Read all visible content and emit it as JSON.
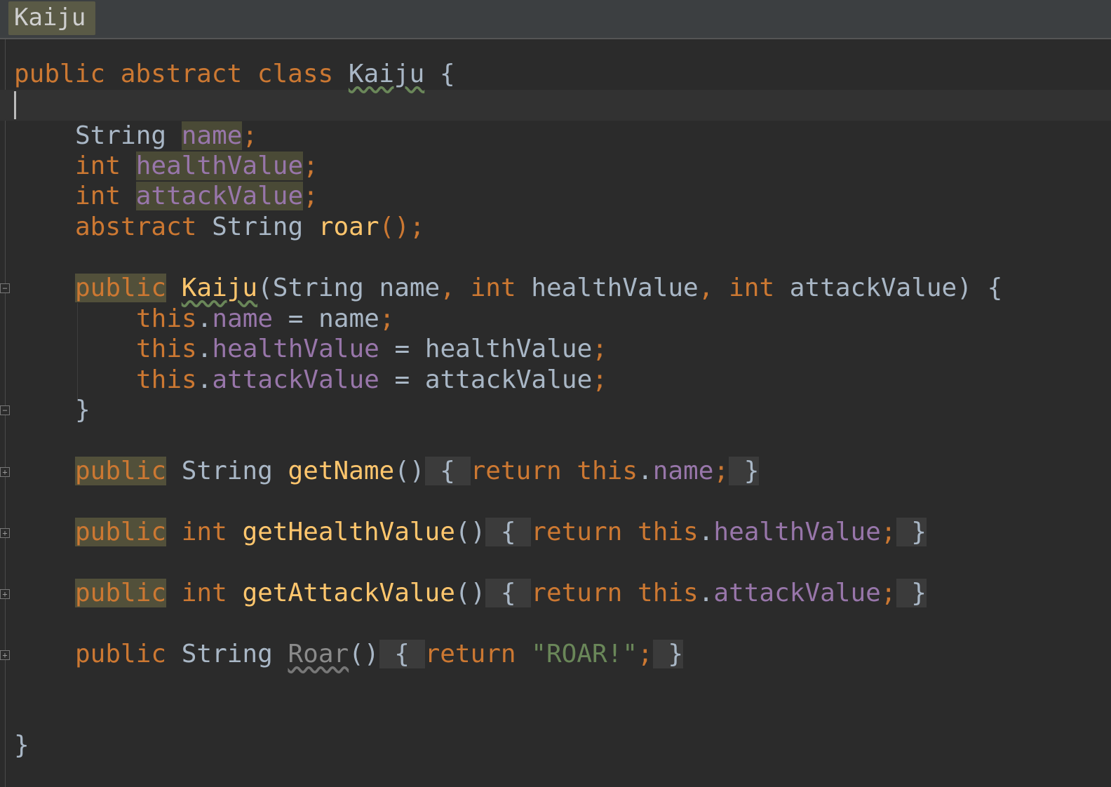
{
  "tab": {
    "label": "Kaiju"
  },
  "code": {
    "l1": {
      "k1": "public",
      "k2": "abstract",
      "k3": "class",
      "name": "Kaiju",
      "brace": "{"
    },
    "l2": {
      "type": "String",
      "field": "name",
      "semi": ";"
    },
    "l3": {
      "type": "int",
      "field": "healthValue",
      "semi": ";"
    },
    "l4": {
      "type": "int",
      "field": "attackValue",
      "semi": ";"
    },
    "l5": {
      "k1": "abstract",
      "type": "String",
      "method": "roar",
      "rest": "();"
    },
    "l6": {
      "k1": "public",
      "name": "Kaiju",
      "open": "(",
      "t1": "String",
      "p1": " name",
      "c1": ",",
      "t2": "int",
      "p2": " healthValue",
      "c2": ",",
      "t3": "int",
      "p3": " attackValue",
      "close": ") {"
    },
    "l7": {
      "this": "this",
      "dot": ".",
      "field": "name",
      "rest": " = name",
      "semi": ";"
    },
    "l8": {
      "this": "this",
      "dot": ".",
      "field": "healthValue",
      "rest": " = healthValue",
      "semi": ";"
    },
    "l9": {
      "this": "this",
      "dot": ".",
      "field": "attackValue",
      "rest": " = attackValue",
      "semi": ";"
    },
    "l10": {
      "brace": "}"
    },
    "l11": {
      "k1": "public",
      "type": "String",
      "method": "getName",
      "paren": "()",
      "ob": " { ",
      "ret": "return",
      "this": "this",
      "dot": ".",
      "field": "name",
      "semi": ";",
      "cb": " }"
    },
    "l12": {
      "k1": "public",
      "type": "int",
      "method": "getHealthValue",
      "paren": "()",
      "ob": " { ",
      "ret": "return",
      "this": "this",
      "dot": ".",
      "field": "healthValue",
      "semi": ";",
      "cb": " }"
    },
    "l13": {
      "k1": "public",
      "type": "int",
      "method": "getAttackValue",
      "paren": "()",
      "ob": " { ",
      "ret": "return",
      "this": "this",
      "dot": ".",
      "field": "attackValue",
      "semi": ";",
      "cb": " }"
    },
    "l14": {
      "k1": "public",
      "type": "String",
      "method": "Roar",
      "paren": "()",
      "ob": " { ",
      "ret": "return",
      "str": "\"ROAR!\"",
      "semi": ";",
      "cb": " }"
    },
    "l15": {
      "brace": "}"
    }
  },
  "colors": {
    "background": "#2b2b2b",
    "keyword": "#cc7832",
    "identifier": "#a9b7c6",
    "field": "#9876aa",
    "method": "#ffc66d",
    "string": "#6a8759"
  }
}
